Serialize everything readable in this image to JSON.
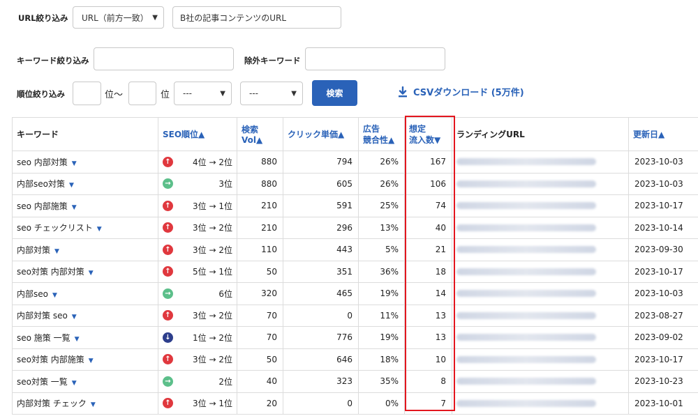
{
  "filters": {
    "url_label": "URL絞り込み",
    "url_mode": "URL（前方一致）",
    "url_value": "B社の記事コンテンツのURL",
    "keyword_label": "キーワード絞り込み",
    "exclude_label": "除外キーワード",
    "rank_label": "順位絞り込み",
    "rank_from_unit": "位～",
    "rank_to_unit": "位",
    "select_a": "---",
    "select_b": "---",
    "search_label": "検索",
    "csv_label": "CSVダウンロード (5万件)"
  },
  "table": {
    "headers": {
      "keyword": "キーワード",
      "seo_rank": "SEO順位▲",
      "volume": "検索Vol▲",
      "cpc": "クリック単価▲",
      "ad_line1": "広告",
      "ad_line2": "競合性▲",
      "traffic_line1": "想定",
      "traffic_line2": "流入数▼",
      "landing": "ランディングURL",
      "updated": "更新日▲"
    },
    "rows": [
      {
        "keyword": "seo 内部対策",
        "trend": "up",
        "rank": "4位 → 2位",
        "vol": "880",
        "cpc": "794",
        "ad": "26%",
        "traffic": "167",
        "date": "2023-10-03"
      },
      {
        "keyword": "内部seo対策",
        "trend": "side",
        "rank": "3位",
        "vol": "880",
        "cpc": "605",
        "ad": "26%",
        "traffic": "106",
        "date": "2023-10-03"
      },
      {
        "keyword": "seo 内部施策",
        "trend": "up",
        "rank": "3位 → 1位",
        "vol": "210",
        "cpc": "591",
        "ad": "25%",
        "traffic": "74",
        "date": "2023-10-17"
      },
      {
        "keyword": "seo チェックリスト",
        "trend": "up",
        "rank": "3位 → 2位",
        "vol": "210",
        "cpc": "296",
        "ad": "13%",
        "traffic": "40",
        "date": "2023-10-14"
      },
      {
        "keyword": "内部対策",
        "trend": "up",
        "rank": "3位 → 2位",
        "vol": "110",
        "cpc": "443",
        "ad": "5%",
        "traffic": "21",
        "date": "2023-09-30"
      },
      {
        "keyword": "seo対策 内部対策",
        "trend": "up",
        "rank": "5位 → 1位",
        "vol": "50",
        "cpc": "351",
        "ad": "36%",
        "traffic": "18",
        "date": "2023-10-17"
      },
      {
        "keyword": "内部seo",
        "trend": "side",
        "rank": "6位",
        "vol": "320",
        "cpc": "465",
        "ad": "19%",
        "traffic": "14",
        "date": "2023-10-03"
      },
      {
        "keyword": "内部対策 seo",
        "trend": "up",
        "rank": "3位 → 2位",
        "vol": "70",
        "cpc": "0",
        "ad": "11%",
        "traffic": "13",
        "date": "2023-08-27"
      },
      {
        "keyword": "seo 施策 一覧",
        "trend": "down",
        "rank": "1位 → 2位",
        "vol": "70",
        "cpc": "776",
        "ad": "19%",
        "traffic": "13",
        "date": "2023-09-02"
      },
      {
        "keyword": "seo対策 内部施策",
        "trend": "up",
        "rank": "3位 → 2位",
        "vol": "50",
        "cpc": "646",
        "ad": "18%",
        "traffic": "10",
        "date": "2023-10-17"
      },
      {
        "keyword": "seo対策 一覧",
        "trend": "side",
        "rank": "2位",
        "vol": "40",
        "cpc": "323",
        "ad": "35%",
        "traffic": "8",
        "date": "2023-10-23"
      },
      {
        "keyword": "内部対策 チェック",
        "trend": "up",
        "rank": "3位 → 1位",
        "vol": "20",
        "cpc": "0",
        "ad": "0%",
        "traffic": "7",
        "date": "2023-10-01"
      }
    ]
  },
  "colors": {
    "accent": "#2a62b8",
    "highlight": "#e3161e",
    "up": "#e0383e",
    "side": "#5cbf8a",
    "down": "#2d3e8c"
  }
}
